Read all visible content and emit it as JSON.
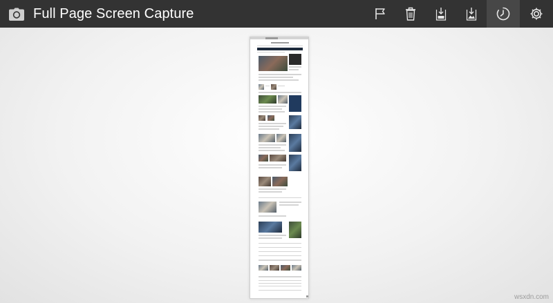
{
  "app": {
    "title": "Full Page Screen Capture",
    "icon": "camera-icon"
  },
  "toolbar": {
    "buttons": [
      {
        "name": "flag-button",
        "icon": "flag-icon"
      },
      {
        "name": "delete-button",
        "icon": "trash-icon"
      },
      {
        "name": "download-pdf-button",
        "icon": "download-pdf-icon"
      },
      {
        "name": "download-image-button",
        "icon": "download-image-icon"
      },
      {
        "name": "timer-button",
        "icon": "timer-icon"
      },
      {
        "name": "settings-button",
        "icon": "gear-icon"
      }
    ]
  },
  "colors": {
    "topbar": "#333333",
    "topbar_active": "#474747",
    "title": "#ffffff"
  },
  "watermark": "wsxdn.com"
}
